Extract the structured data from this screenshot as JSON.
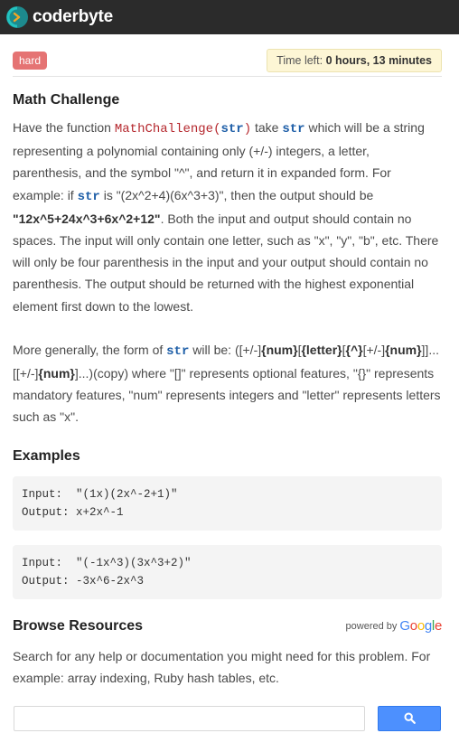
{
  "header": {
    "brand": "coderbyte",
    "logo_icon": "coderbyte-logo-icon"
  },
  "meta": {
    "difficulty": "hard",
    "timer_label": "Time left: ",
    "timer_value": "0 hours, 13 minutes"
  },
  "challenge": {
    "title": "Math Challenge",
    "p1": {
      "t1": "Have the function ",
      "fn": "MathChallenge(",
      "fn_arg": "str",
      "fn_close": ")",
      "t2": " take ",
      "kw1": "str",
      "t3": " which will be a string representing a polynomial containing only (+/-) integers, a letter, parenthesis, and the symbol \"^\", and return it in expanded form. For example: if ",
      "kw2": "str",
      "t4": " is \"(2x^2+4)(6x^3+3)\", then the output should be ",
      "bold": "\"12x^5+24x^3+6x^2+12\"",
      "t5": ". Both the input and output should contain no spaces. The input will only contain one letter, such as \"x\", \"y\", \"b\", etc. There will only be four parenthesis in the input and your output should contain no parenthesis. The output should be returned with the highest exponential element first down to the lowest."
    },
    "p2": {
      "t1": "More generally, the form of ",
      "kw": "str",
      "t2": " will be: ([+/-]",
      "b1": "{num}",
      "t3": "[",
      "b2": "{letter}",
      "t4": "[",
      "b3": "{^}",
      "t5": "[+/-]",
      "b4": "{num}",
      "t6": "]]...[[+/-]",
      "b5": "{num}",
      "t7": "]...)(copy) where \"[]\" represents optional features, \"{}\" represents mandatory features, \"num\" represents integers and \"letter\" represents letters such as \"x\"."
    }
  },
  "examples": {
    "title": "Examples",
    "items": [
      {
        "input": "Input:  \"(1x)(2x^-2+1)\"",
        "output": "Output: x+2x^-1"
      },
      {
        "input": "Input:  \"(-1x^3)(3x^3+2)\"",
        "output": "Output: -3x^6-2x^3"
      }
    ]
  },
  "resources": {
    "title": "Browse Resources",
    "powered_by": "powered by",
    "google": {
      "G": "G",
      "o1": "o",
      "o2": "o",
      "g": "g",
      "l": "l",
      "e": "e"
    },
    "text": "Search for any help or documentation you might need for this problem. For example: array indexing, Ruby hash tables, etc.",
    "search_icon": "search-icon"
  }
}
